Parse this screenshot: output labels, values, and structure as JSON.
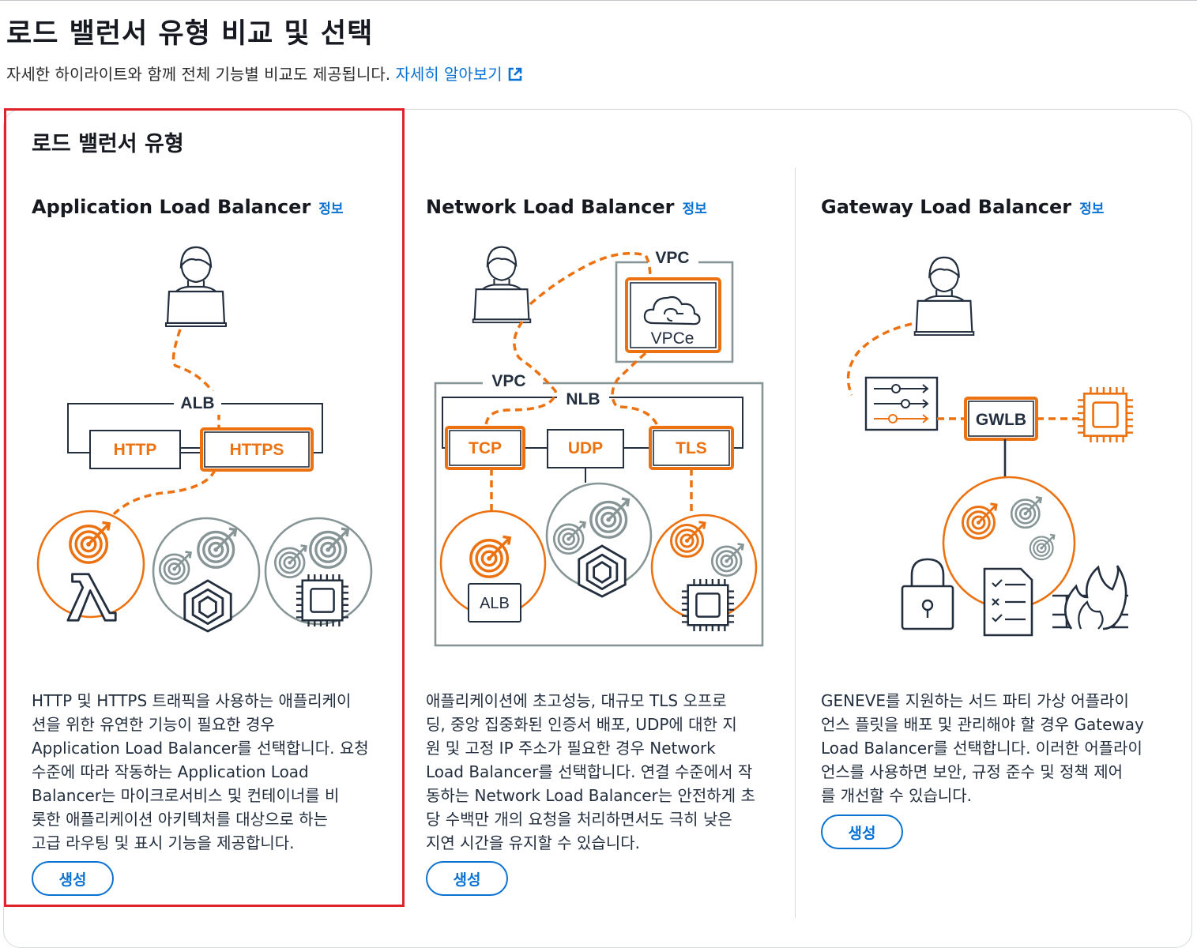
{
  "page": {
    "title": "로드 밸런서 유형 비교 및 선택",
    "subtitle": "자세한 하이라이트와 함께 전체 기능별 비교도 제공됩니다.",
    "learn_more": "자세히 알아보기"
  },
  "section": {
    "title": "로드 밸런서 유형"
  },
  "info_label": "정보",
  "cards": [
    {
      "title": "Application Load Balancer",
      "desc_lines": [
        "HTTP 및 HTTPS 트래픽을 사용하는 애플리케이",
        "션을 위한 유연한 기능이 필요한 경우",
        "Application Load Balancer를 선택합니다. 요청",
        "수준에 따라 작동하는 Application Load",
        "Balancer는 마이크로서비스 및 컨테이너를 비",
        "롯한 애플리케이션 아키텍처를 대상으로 하는",
        "고급 라우팅 및 표시 기능을 제공합니다."
      ],
      "button": "생성",
      "selected": true,
      "diagram": {
        "group": "ALB",
        "listeners": [
          "HTTP",
          "HTTPS"
        ]
      }
    },
    {
      "title": "Network Load Balancer",
      "desc_lines": [
        "애플리케이션에 초고성능, 대규모 TLS 오프로",
        "딩, 중앙 집중화된 인증서 배포, UDP에 대한 지",
        "원 및 고정 IP 주소가 필요한 경우 Network",
        "Load Balancer를 선택합니다. 연결 수준에서 작",
        "동하는 Network Load Balancer는 안전하게 초",
        "당 수백만 개의 요청을 처리하면서도 극히 낮은",
        "지연 시간을 유지할 수 있습니다."
      ],
      "button": "생성",
      "selected": false,
      "diagram": {
        "vpc": "VPC",
        "endpoint": "VPCe",
        "group": "NLB",
        "listeners": [
          "TCP",
          "UDP",
          "TLS"
        ],
        "target": "ALB"
      }
    },
    {
      "title": "Gateway Load Balancer",
      "desc_lines": [
        "GENEVE를 지원하는 서드 파티 가상 어플라이",
        "언스 플릿을 배포 및 관리해야 할 경우 Gateway",
        "Load Balancer를 선택합니다. 이러한 어플라이",
        "언스를 사용하면 보안, 규정 준수 및 정책 제어",
        "를 개선할 수 있습니다."
      ],
      "button": "생성",
      "selected": false,
      "diagram": {
        "group": "GWLB"
      }
    }
  ],
  "colors": {
    "accent": "#ec7211",
    "link": "#0972d3",
    "selection": "#e0222a",
    "gray": "#879596",
    "text": "#16191f"
  }
}
